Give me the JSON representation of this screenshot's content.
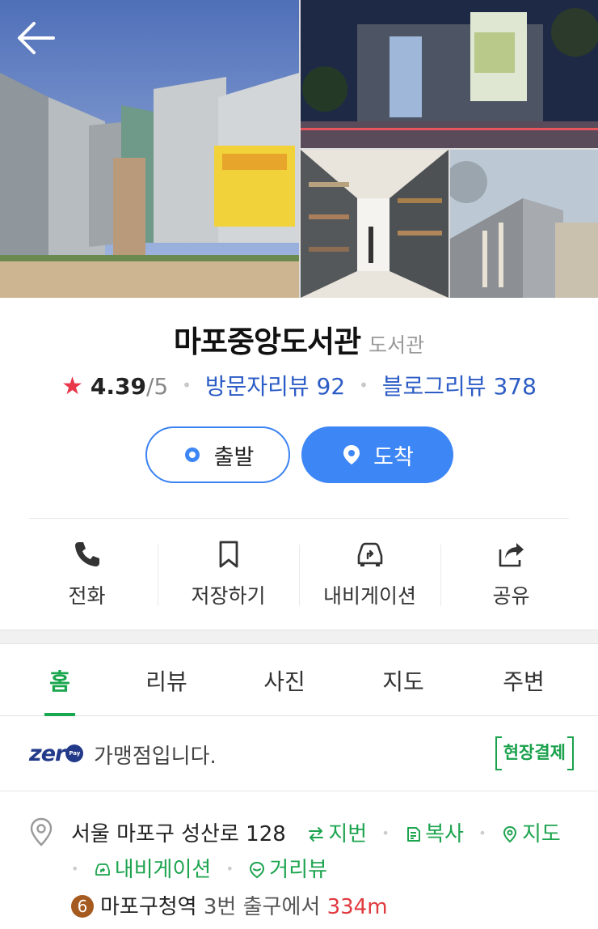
{
  "place": {
    "name": "마포중앙도서관",
    "category": "도서관"
  },
  "rating": {
    "score": "4.39",
    "max": "/5",
    "visitor_reviews": "방문자리뷰 92",
    "blog_reviews": "블로그리뷰 378"
  },
  "route": {
    "depart_label": "출발",
    "arrive_label": "도착"
  },
  "actions": [
    {
      "label": "전화",
      "icon": "phone-icon"
    },
    {
      "label": "저장하기",
      "icon": "bookmark-icon"
    },
    {
      "label": "내비게이션",
      "icon": "car-navigation-icon"
    },
    {
      "label": "공유",
      "icon": "share-icon"
    }
  ],
  "tabs": [
    {
      "label": "홈",
      "active": true
    },
    {
      "label": "리뷰",
      "active": false
    },
    {
      "label": "사진",
      "active": false
    },
    {
      "label": "지도",
      "active": false
    },
    {
      "label": "주변",
      "active": false
    }
  ],
  "zeropay": {
    "logo": "zero Pay",
    "label": "가맹점입니다.",
    "badge": "현장결제"
  },
  "address": {
    "road": "서울 마포구 성산로 128",
    "links": {
      "jibun": "지번",
      "copy": "복사",
      "map": "지도",
      "navigation": "내비게이션",
      "streetview": "거리뷰"
    }
  },
  "transit": {
    "line": "6",
    "line_color": "#a55a1f",
    "station": "마포구청역",
    "exit": "3번 출구에서",
    "distance": "334m"
  },
  "colors": {
    "accent_blue": "#3d86f5",
    "link_blue": "#2c5cc5",
    "green": "#19a84f",
    "star_red": "#e8364a"
  }
}
